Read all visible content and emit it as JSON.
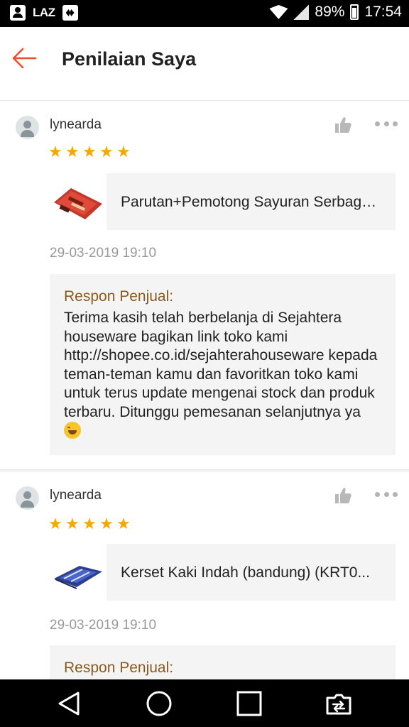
{
  "status_bar": {
    "laz_label": "LAZ",
    "battery_percent": "89%",
    "time": "17:54"
  },
  "header": {
    "title": "Penilaian Saya"
  },
  "reviews": [
    {
      "username": "lynearda",
      "rating": 5,
      "product_name": "Parutan+Pemotong Sayuran Serbaguna",
      "timestamp": "29-03-2019 19:10",
      "response_title": "Respon Penjual:",
      "response_text": "Terima kasih telah berbelanja di Sejahtera houseware bagikan link toko kami http://shopee.co.id/sejahterahouseware kepada teman-teman kamu dan favoritkan toko kami untuk terus update mengenai stock dan produk terbaru. Ditunggu pemesanan selanjutnya ya"
    },
    {
      "username": "lynearda",
      "rating": 5,
      "product_name": "Kerset Kaki Indah (bandung) (KRT0...",
      "timestamp": "29-03-2019 19:10",
      "response_title": "Respon Penjual:",
      "response_text": ""
    }
  ],
  "colors": {
    "accent": "#ee4d2d",
    "star": "#f6a700",
    "response_title": "#8a5a1e"
  },
  "icons": {
    "back": "arrow-left-icon",
    "like": "thumbs-up-icon",
    "more": "more-horizontal-icon",
    "nav_back": "triangle-back-icon",
    "nav_home": "circle-home-icon",
    "nav_recents": "square-recents-icon",
    "nav_switch": "screen-switch-icon"
  }
}
